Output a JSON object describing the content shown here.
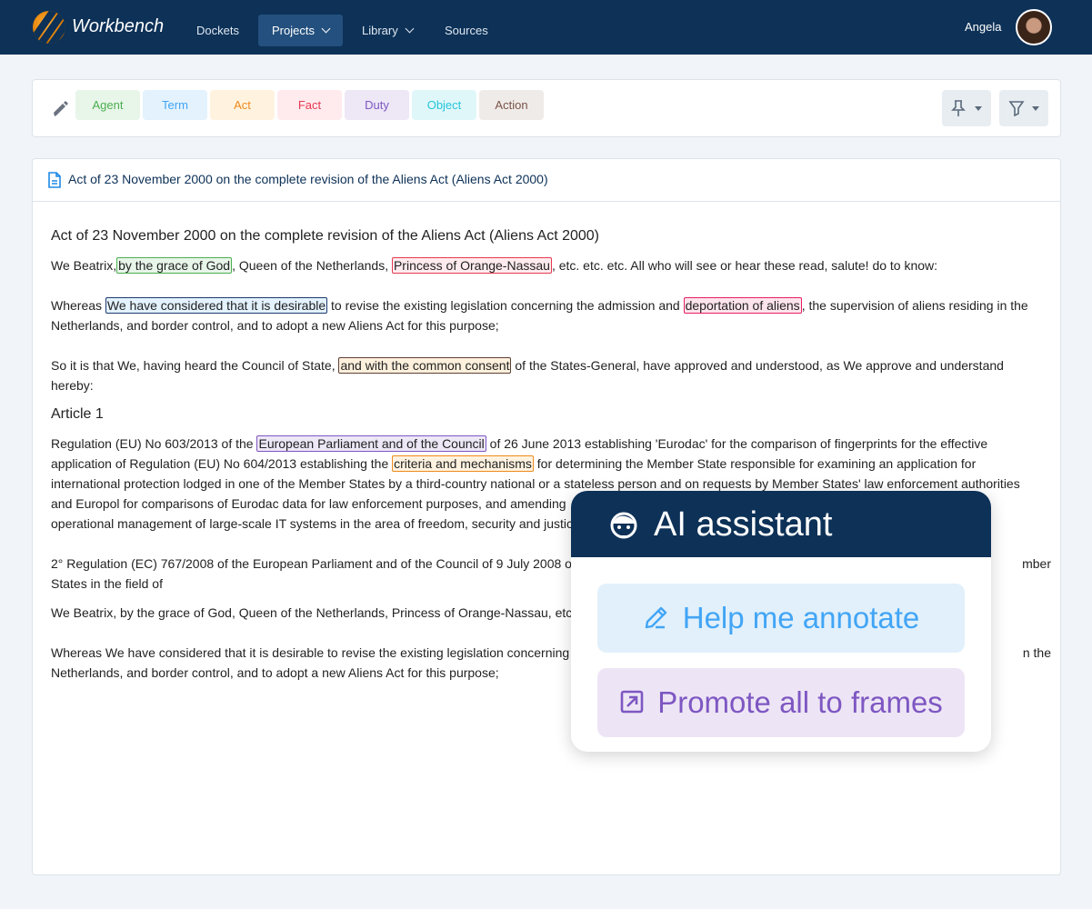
{
  "nav": {
    "brand": "Workbench",
    "items": [
      {
        "label": "Dockets"
      },
      {
        "label": "Projects"
      },
      {
        "label": "Library"
      },
      {
        "label": "Sources"
      }
    ],
    "user": "Angela"
  },
  "toolbar": {
    "tags": [
      {
        "label": "Agent",
        "color": "#4caf50",
        "bg": "#e8f5e9"
      },
      {
        "label": "Term",
        "color": "#42a5f5",
        "bg": "#e3f2fd"
      },
      {
        "label": "Act",
        "color": "#ef8a1c",
        "bg": "#fff3e0"
      },
      {
        "label": "Fact",
        "color": "#e53950",
        "bg": "#ffebee"
      },
      {
        "label": "Duty",
        "color": "#7e57c2",
        "bg": "#ede7f6"
      },
      {
        "label": "Object",
        "color": "#26c6da",
        "bg": "#e0f7fa"
      },
      {
        "label": "Action",
        "color": "#795548",
        "bg": "#efebe9"
      }
    ]
  },
  "document": {
    "tab_title": "Act of 23 November 2000 on the complete revision of the Aliens Act (Aliens Act 2000)",
    "heading": "Act of 23 November 2000 on the complete revision of the Aliens Act (Aliens Act 2000)",
    "p1": {
      "a": "We Beatrix,",
      "h1": "by the grace of God",
      "b": ", Queen of the Netherlands, ",
      "h2": "Princess of Orange-Nassau",
      "c": ", etc. etc. etc. All who will see or hear these read, salute! do to know:"
    },
    "p2": {
      "a": "Whereas ",
      "h1": "We have considered that it is desirable",
      "b": " to revise the existing legislation concerning the admission and ",
      "h2": "deportation of aliens",
      "c": ", the supervision of aliens residing in the",
      "l2": "Netherlands, and border control, and to adopt a new Aliens Act for this purpose;"
    },
    "p3": {
      "a": "So it is that We, having heard the Council of State, ",
      "h1": "and with the common consent",
      "b": " of the States-General, have approved and understood, as We approve and understand",
      "l2": "hereby:"
    },
    "article": "Article 1",
    "p4": {
      "a": "Regulation (EU) No 603/2013 of the ",
      "h1": "European Parliament and of the Council",
      "b": " of 26 June 2013 establishing 'Eurodac' for the comparison of fingerprints for the effective",
      "c": "application of Regulation (EU) No 604/2013 establishing the ",
      "h2": "criteria and mechanisms",
      "d": " for determining the Member State responsible for examining an application for",
      "l3": "international protection lodged in one of the Member States by a third-country national or a stateless person and on requests by Member States' law enforcement authorities",
      "l4": "and Europol for comparisons of Eurodac data for law enforcement purposes, and amending",
      "l5": "operational management of large-scale IT systems in the area of freedom, security and justic"
    },
    "p5": {
      "l1": "2° Regulation (EC) 767/2008 of the European Parliament and of the Council of 9 July 2008 o",
      "l1r": "mber",
      "l2": "States in the field of"
    },
    "p6": {
      "l1": "We Beatrix, by the grace of God, Queen of the Netherlands, Princess of Orange-Nassau, etc. e"
    },
    "p7": {
      "l1": "Whereas We have considered that it is desirable to revise the existing legislation concerning",
      "l1r": "n the",
      "l2": "Netherlands, and border control, and to adopt a new Aliens Act for this purpose;"
    }
  },
  "assistant": {
    "title": "AI assistant",
    "annotate": "Help me annotate",
    "promote": "Promote all to frames"
  }
}
